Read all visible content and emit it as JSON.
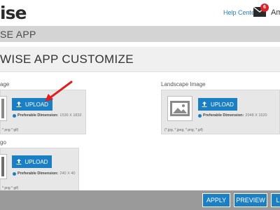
{
  "header": {
    "logo": "ise",
    "help_link": "Help Center",
    "mail_count": "6",
    "user_name": "Am"
  },
  "section": {
    "title": "SE APP"
  },
  "page": {
    "title": "WISE APP CUSTOMIZE"
  },
  "portrait": {
    "label": "age",
    "upload_label": "UPLOAD",
    "dim_label": "Preferable Dimension:",
    "dim_value": "1536 X 1832",
    "formats": "* png * gif)"
  },
  "landscape": {
    "label": "Landscape Image",
    "upload_label": "UPLOAD",
    "dim_label": "Preferable Dimension:",
    "dim_value": "2048 X 1520",
    "formats": "(*.jpg, *.jpeg, *.png, *.gif)"
  },
  "logo_field": {
    "label": "go",
    "upload_label": "UPLOAD",
    "dim_label": "Preferable Dimension:",
    "dim_value": "240 X 40",
    "formats": "* png * gif)"
  },
  "footer": {
    "apply": "APPLY",
    "preview": "PREVIEW",
    "last": "L"
  },
  "colors": {
    "accent": "#1b7fc4",
    "badge": "#d9232d",
    "arrow": "#e02020"
  }
}
